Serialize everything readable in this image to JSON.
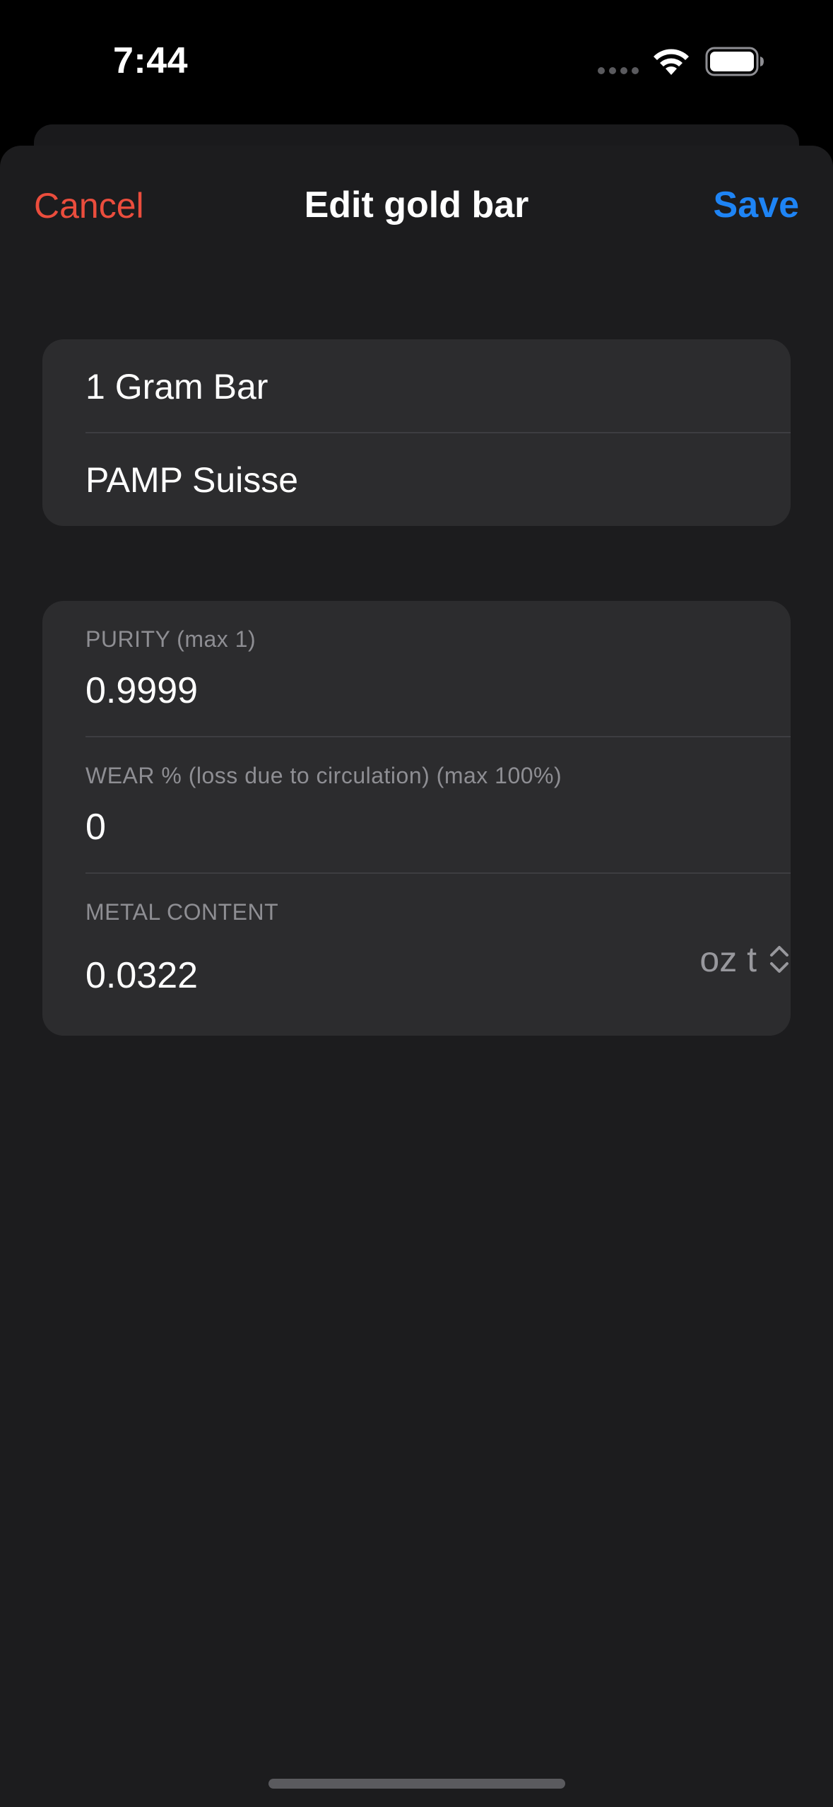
{
  "status_bar": {
    "time": "7:44"
  },
  "nav": {
    "cancel_label": "Cancel",
    "title": "Edit gold bar",
    "save_label": "Save"
  },
  "item_group": {
    "name": "1 Gram Bar",
    "manufacturer": "PAMP Suisse"
  },
  "specs_group": {
    "purity_caption": "PURITY (max 1)",
    "purity_value": "0.9999",
    "wear_caption": "WEAR % (loss due to circulation) (max 100%)",
    "wear_value": "0",
    "metal_caption": "METAL CONTENT",
    "metal_value": "0.0322",
    "unit_selected": "oz t"
  },
  "icons": {
    "wifi": "wifi-icon",
    "battery": "battery-icon",
    "cellular": "cellular-signal-icon",
    "picker": "chevron-up-down-icon"
  },
  "colors": {
    "background": "#1c1c1e",
    "cell": "#2c2c2e",
    "cancel": "#eb4d3d",
    "save": "#1e84f5",
    "caption": "#8e8e93"
  }
}
